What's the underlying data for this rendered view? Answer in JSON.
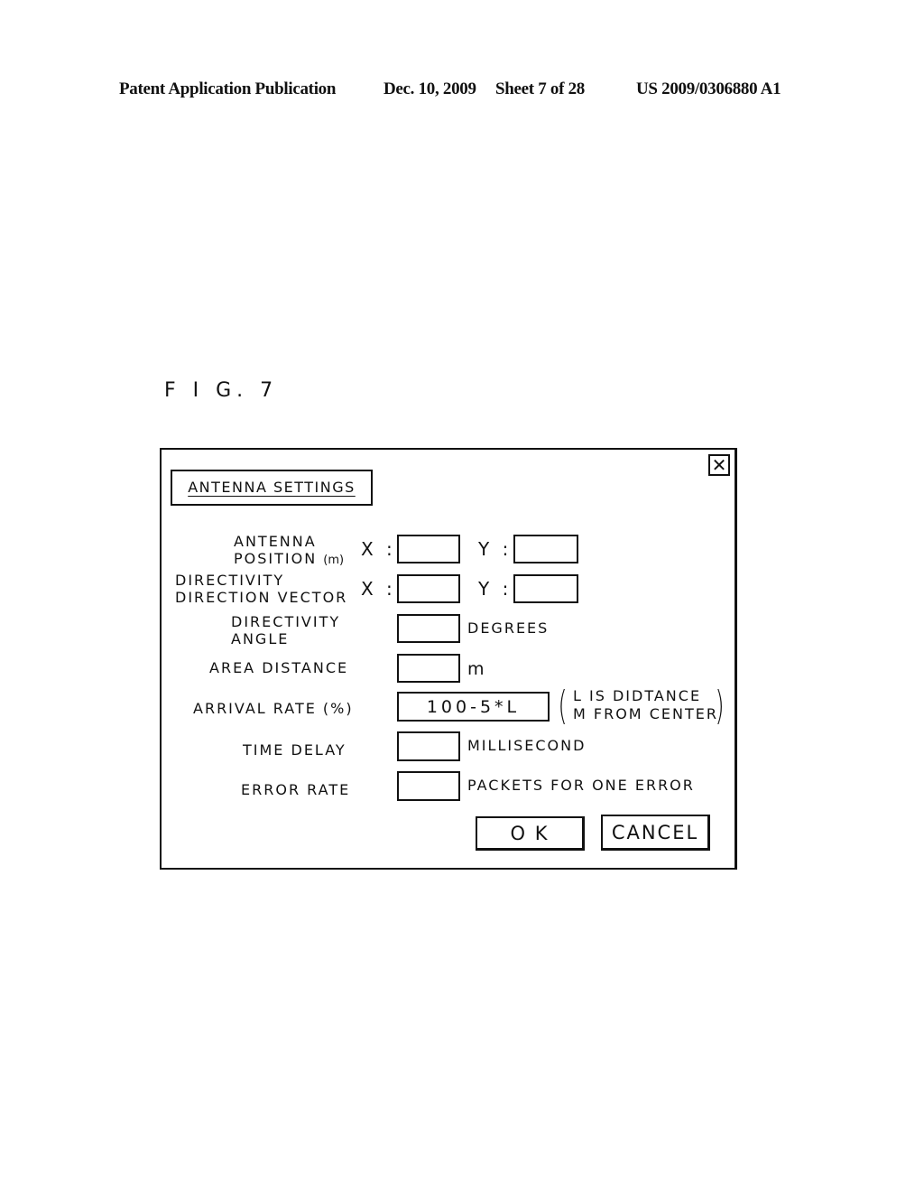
{
  "header": {
    "publication": "Patent Application Publication",
    "date": "Dec. 10, 2009",
    "sheet": "Sheet 7 of 28",
    "number": "US 2009/0306880 A1"
  },
  "figure_label": "F I G. 7",
  "dialog": {
    "title": "ANTENNA SETTINGS",
    "close_icon": "close-icon",
    "antenna_position": {
      "label_line1": "ANTENNA",
      "label_line2": "POSITION",
      "label_unit": "(m)",
      "x_label": "X :",
      "y_label": "Y :",
      "x_value": "",
      "y_value": ""
    },
    "direction_vector": {
      "label_line1": "DIRECTIVITY",
      "label_line2": "DIRECTION VECTOR",
      "x_label": "X :",
      "y_label": "Y :",
      "x_value": "",
      "y_value": ""
    },
    "directivity_angle": {
      "label_line1": "DIRECTIVITY",
      "label_line2": "ANGLE",
      "value": "",
      "unit": "DEGREES"
    },
    "area_distance": {
      "label": "AREA DISTANCE",
      "value": "",
      "unit": "m"
    },
    "arrival_rate": {
      "label": "ARRIVAL RATE (%)",
      "value": "100-5*L",
      "note_line1": "L  IS DIDTANCE",
      "note_line2": "M  FROM CENTER"
    },
    "time_delay": {
      "label": "TIME DELAY",
      "value": "",
      "unit": "MILLISECOND"
    },
    "error_rate": {
      "label": "ERROR RATE",
      "value": "",
      "unit": "PACKETS FOR ONE ERROR"
    },
    "buttons": {
      "ok": "O  K",
      "cancel": "CANCEL"
    }
  }
}
